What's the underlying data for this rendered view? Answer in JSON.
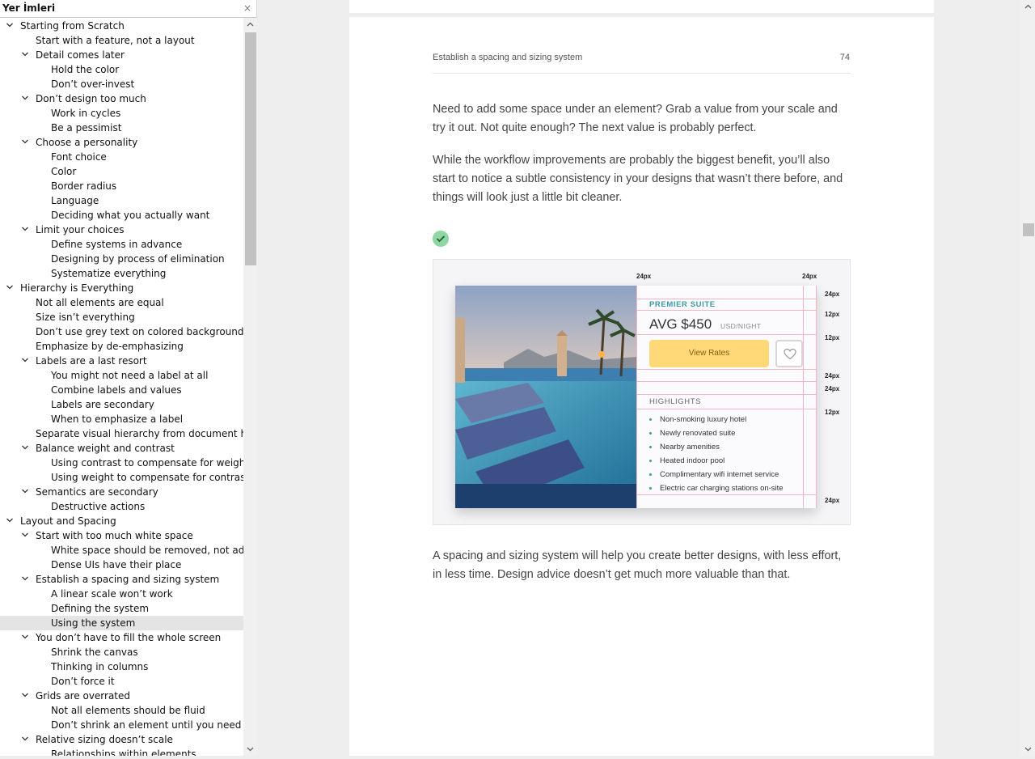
{
  "sidebar": {
    "title": "Yer İmleri",
    "close_glyph": "×",
    "items": [
      {
        "label": "Starting from Scratch",
        "level": 0,
        "expanded": true
      },
      {
        "label": "Start with a feature, not a layout",
        "level": 1,
        "expanded": null
      },
      {
        "label": "Detail comes later",
        "level": 1,
        "expanded": true
      },
      {
        "label": "Hold the color",
        "level": 2,
        "expanded": null
      },
      {
        "label": "Don’t over-invest",
        "level": 2,
        "expanded": null
      },
      {
        "label": "Don’t design too much",
        "level": 1,
        "expanded": true
      },
      {
        "label": "Work in cycles",
        "level": 2,
        "expanded": null
      },
      {
        "label": "Be a pessimist",
        "level": 2,
        "expanded": null
      },
      {
        "label": "Choose a personality",
        "level": 1,
        "expanded": true
      },
      {
        "label": "Font choice",
        "level": 2,
        "expanded": null
      },
      {
        "label": "Color",
        "level": 2,
        "expanded": null
      },
      {
        "label": "Border radius",
        "level": 2,
        "expanded": null
      },
      {
        "label": "Language",
        "level": 2,
        "expanded": null
      },
      {
        "label": "Deciding what you actually want",
        "level": 2,
        "expanded": null
      },
      {
        "label": "Limit your choices",
        "level": 1,
        "expanded": true
      },
      {
        "label": "Define systems in advance",
        "level": 2,
        "expanded": null
      },
      {
        "label": "Designing by process of elimination",
        "level": 2,
        "expanded": null
      },
      {
        "label": "Systematize everything",
        "level": 2,
        "expanded": null
      },
      {
        "label": "Hierarchy is Everything",
        "level": 0,
        "expanded": true
      },
      {
        "label": "Not all elements are equal",
        "level": 1,
        "expanded": null
      },
      {
        "label": "Size isn’t everything",
        "level": 1,
        "expanded": null
      },
      {
        "label": "Don’t use grey text on colored backgrounds",
        "level": 1,
        "expanded": null
      },
      {
        "label": "Emphasize by de-emphasizing",
        "level": 1,
        "expanded": null
      },
      {
        "label": "Labels are a last resort",
        "level": 1,
        "expanded": true
      },
      {
        "label": "You might not need a label at all",
        "level": 2,
        "expanded": null
      },
      {
        "label": "Combine labels and values",
        "level": 2,
        "expanded": null
      },
      {
        "label": "Labels are secondary",
        "level": 2,
        "expanded": null
      },
      {
        "label": "When to emphasize a label",
        "level": 2,
        "expanded": null
      },
      {
        "label": "Separate visual hierarchy from document hierarc",
        "level": 1,
        "expanded": null
      },
      {
        "label": "Balance weight and contrast",
        "level": 1,
        "expanded": true
      },
      {
        "label": "Using contrast to compensate for weight",
        "level": 2,
        "expanded": null
      },
      {
        "label": "Using weight to compensate for contrast",
        "level": 2,
        "expanded": null
      },
      {
        "label": "Semantics are secondary",
        "level": 1,
        "expanded": true
      },
      {
        "label": "Destructive actions",
        "level": 2,
        "expanded": null
      },
      {
        "label": "Layout and Spacing",
        "level": 0,
        "expanded": true
      },
      {
        "label": "Start with too much white space",
        "level": 1,
        "expanded": true
      },
      {
        "label": "White space should be removed, not added",
        "level": 2,
        "expanded": null
      },
      {
        "label": "Dense UIs have their place",
        "level": 2,
        "expanded": null
      },
      {
        "label": "Establish a spacing and sizing system",
        "level": 1,
        "expanded": true
      },
      {
        "label": "A linear scale won’t work",
        "level": 2,
        "expanded": null
      },
      {
        "label": "Defining the system",
        "level": 2,
        "expanded": null
      },
      {
        "label": "Using the system",
        "level": 2,
        "expanded": null,
        "selected": true
      },
      {
        "label": "You don’t have to fill the whole screen",
        "level": 1,
        "expanded": true
      },
      {
        "label": "Shrink the canvas",
        "level": 2,
        "expanded": null
      },
      {
        "label": "Thinking in columns",
        "level": 2,
        "expanded": null
      },
      {
        "label": "Don’t force it",
        "level": 2,
        "expanded": null
      },
      {
        "label": "Grids are overrated",
        "level": 1,
        "expanded": true
      },
      {
        "label": "Not all elements should be fluid",
        "level": 2,
        "expanded": null
      },
      {
        "label": "Don’t shrink an element until you need to",
        "level": 2,
        "expanded": null
      },
      {
        "label": "Relative sizing doesn’t scale",
        "level": 1,
        "expanded": true
      },
      {
        "label": "Relationships within elements",
        "level": 2,
        "expanded": null
      }
    ]
  },
  "page": {
    "running_title": "Establish a spacing and sizing system",
    "page_number": "74",
    "paragraphs": [
      "Need to add some space under an element? Grab a value from your scale and try it out. Not quite enough? The next value is probably perfect.",
      "While the workflow improvements are probably the biggest benefit, you’ll also start to notice a subtle consistency in your designs that wasn’t there before, and things will look just a little bit cleaner.",
      "A spacing and sizing system will help you create better designs, with less effort, in less time. Design advice doesn’t get much more valuable than that."
    ],
    "check_icon": "check-icon",
    "figure": {
      "spacing_labels": [
        "24px",
        "24px",
        "24px",
        "12px",
        "12px",
        "24px",
        "24px",
        "12px",
        "24px"
      ],
      "suite_title": "PREMIER SUITE",
      "price": "AVG $450",
      "price_unit": "USD/NIGHT",
      "button_label": "View Rates",
      "heart_icon": "heart-icon",
      "highlights_title": "HIGHLIGHTS",
      "highlights": [
        "Non-smoking luxury hotel",
        "Newly renovated suite",
        "Nearby amenities",
        "Heated indoor pool",
        "Complimentary wifi internet service",
        "Electric car charging stations on-site"
      ]
    }
  },
  "colors": {
    "accent_teal": "#3c9aa3",
    "button_yellow": "#ffd978",
    "check_green": "#8fd6a2",
    "selection_grey": "#e4e4e4"
  }
}
